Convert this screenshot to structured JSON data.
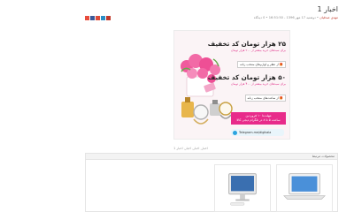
{
  "page": {
    "title": "اخبار 1",
    "meta_author": "مهدی صدقیان",
    "meta_rest": " • دوشنبه 17 مهر 1396 - 16:51:50 • 0 دیدگاه",
    "share_colors": [
      "#e74c3c",
      "#3b5998",
      "#dd4b39",
      "#2b8cc4",
      "#c0392b"
    ],
    "tags": "اخبار, اخبار, اخبار, اخبار 1"
  },
  "banner": {
    "offer1_big": "۲۵ هزار تومان کد تخفیف",
    "offer1_small": "برای سبدهای خرید بیشتر از ۲۰۰ هزار تومان",
    "offer1_pill": "از عطر و لوازم‌های منتخب زنانه",
    "offer2_big": "۵۰ هزار تومان کد تخفیف",
    "offer2_small": "برای سبدهای خرید بیشتر از ۴۰۰ هزار تومان",
    "offer2_pill": "از ساعت‌های منتخب زنانه",
    "deadline_line1": "مهلت‌تا ۱۰ فروردین",
    "deadline_line2": "ساعت ۵ تا ۸ در تلگرام دیجی کالا",
    "telegram_link": "Telegram.me/digikala",
    "icon_telegram": "telegram-icon",
    "icon_gift": "gift-icon",
    "color_pink": "#e82b8a"
  },
  "related": {
    "heading": "محصولات مرتبط"
  }
}
